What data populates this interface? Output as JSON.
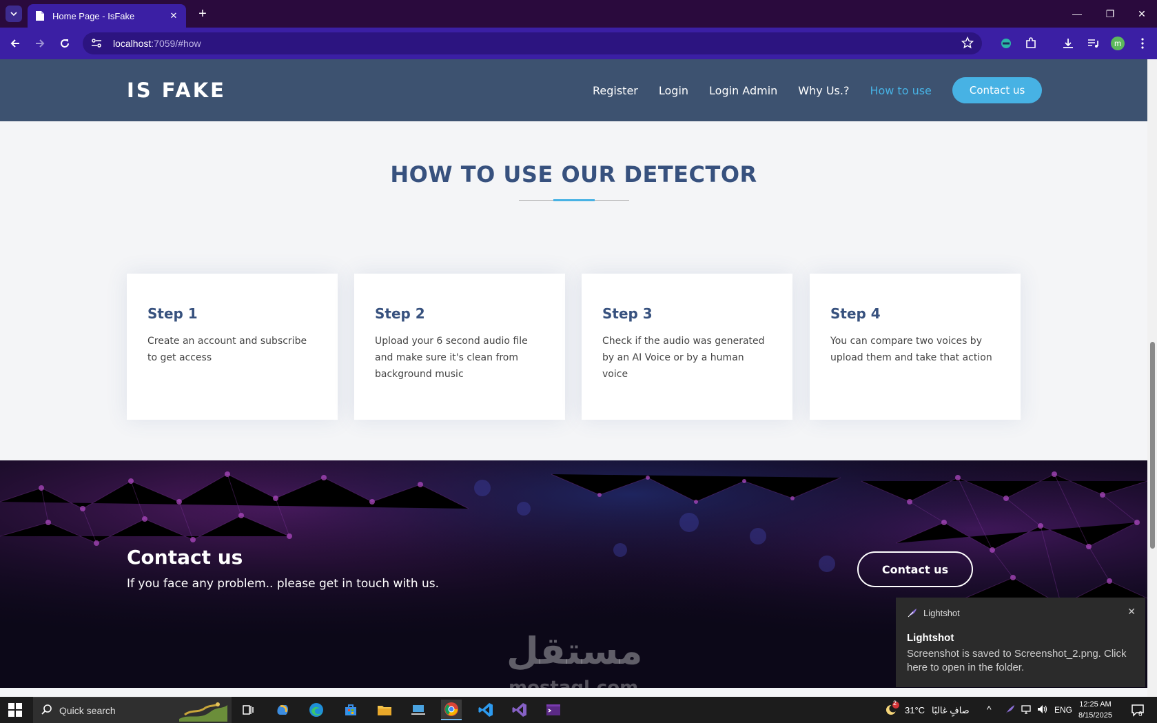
{
  "browser": {
    "tab_title": "Home Page - IsFake",
    "url_host": "localhost",
    "url_rest": ":7059/#how",
    "profile_initial": "m"
  },
  "site": {
    "logo": "IS FAKE",
    "nav": [
      {
        "label": "Register",
        "active": false
      },
      {
        "label": "Login",
        "active": false
      },
      {
        "label": "Login Admin",
        "active": false
      },
      {
        "label": "Why Us.?",
        "active": false
      },
      {
        "label": "How to use",
        "active": true
      }
    ],
    "nav_cta": "Contact us",
    "accent_color": "#47b2e4",
    "header_color": "#3d5270"
  },
  "how": {
    "title": "HOW TO USE OUR DETECTOR",
    "steps": [
      {
        "title": "Step 1",
        "text": "Create an account and subscribe to get access"
      },
      {
        "title": "Step 2",
        "text": "Upload your 6 second audio file and make sure it's clean from background music"
      },
      {
        "title": "Step 3",
        "text": "Check if the audio was generated by an AI Voice or by a human voice"
      },
      {
        "title": "Step 4",
        "text": "You can compare two voices by upload them and take that action"
      }
    ]
  },
  "contact": {
    "title": "Contact us",
    "subtitle": "If you face any problem.. please get in touch with us.",
    "button": "Contact us"
  },
  "watermark": {
    "arabic": "مستقل",
    "latin": "mostaql.com"
  },
  "toast": {
    "app": "Lightshot",
    "title": "Lightshot",
    "body": "Screenshot is saved to Screenshot_2.png. Click here to open in the folder."
  },
  "taskbar": {
    "search_placeholder": "Quick search",
    "weather": "31°C",
    "weather_desc": "صافٍ غالبًا",
    "weather_badge": "2",
    "lang": "ENG",
    "time": "12:25 AM",
    "date": "8/15/2025",
    "notif_count": "6"
  }
}
